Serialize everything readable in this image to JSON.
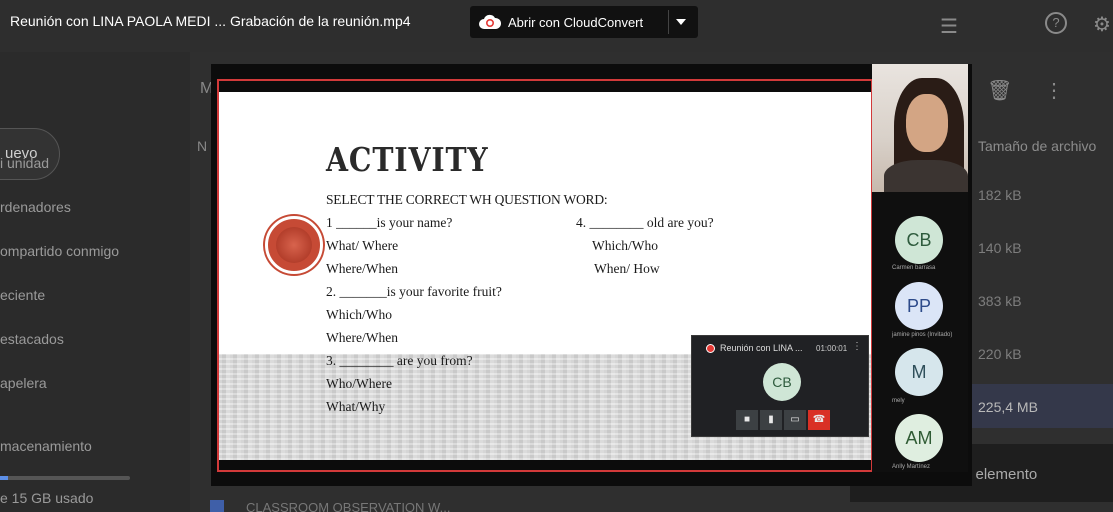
{
  "viewer": {
    "file_title": "Reunión con LINA PAOLA MEDI ... Grabación de la reunión.mp4",
    "open_with_label": "Abrir con CloudConvert"
  },
  "background": {
    "new_label": "uevo",
    "nav": [
      "i unidad",
      "rdenadores",
      "ompartido conmigo",
      "eciente",
      "estacados",
      "apelera",
      "macenamiento"
    ],
    "storage_text": "e 15 GB usado",
    "size_header": "Tamaño de archivo",
    "sizes": [
      "182 kB",
      "140 kB",
      "383 kB",
      "220 kB",
      "225,4 MB"
    ],
    "toast_text": "l elemento",
    "bottom_file": "CLASSROOM OBSERVATION W...",
    "header_left_letter": "M",
    "col_letter": "N"
  },
  "slide": {
    "title": "ACTIVITY",
    "subtitle": "SELECT THE CORRECT WH QUESTION WORD:",
    "left_column": [
      "1 ______is your name?",
      "What/ Where",
      "Where/When",
      "2. _______is your favorite fruit?",
      "Which/Who",
      "Where/When",
      "3. ________ are you from?",
      "Who/Where",
      "What/Why"
    ],
    "right_column": [
      "4. ________ old are you?",
      "Which/Who",
      "When/ How"
    ]
  },
  "mini_meet": {
    "title": "Reunión con LINA ...",
    "time": "01:00:01",
    "avatar": "CB"
  },
  "participants": [
    {
      "initials": "CB",
      "name": "Carmen barrasa",
      "bg": "#cfe6d6",
      "fg": "#2e5b3d"
    },
    {
      "initials": "PP",
      "name": "jamine pinos (Invitado)",
      "bg": "#dbe5f7",
      "fg": "#2d4a8a"
    },
    {
      "initials": "M",
      "name": "mely",
      "bg": "#d6e6ec",
      "fg": "#2f4f5a"
    },
    {
      "initials": "AM",
      "name": "Anlly Martínez",
      "bg": "#dfeee0",
      "fg": "#2f5b34"
    }
  ]
}
